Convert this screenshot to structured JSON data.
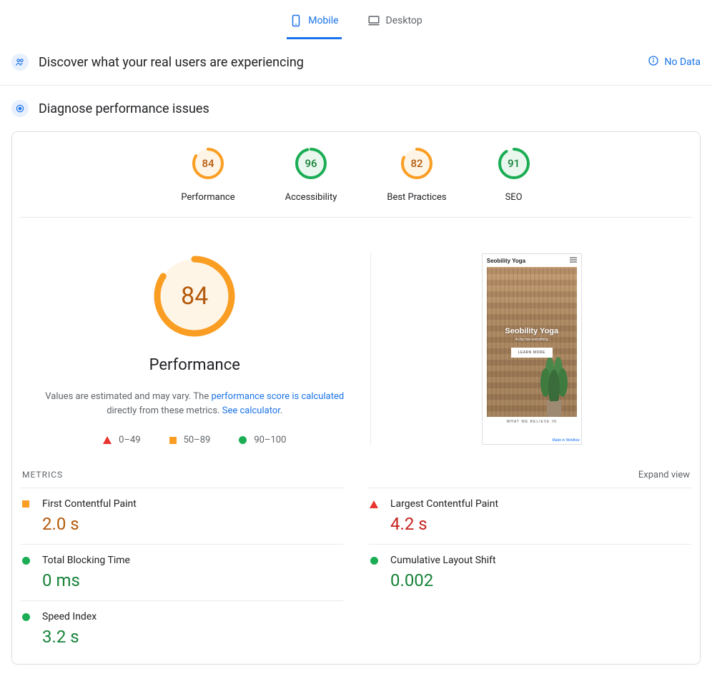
{
  "tabs": {
    "mobile": "Mobile",
    "desktop": "Desktop"
  },
  "discover": {
    "title": "Discover what your real users are experiencing",
    "no_data": "No Data"
  },
  "diagnose": {
    "title": "Diagnose performance issues"
  },
  "gauges": {
    "performance": {
      "label": "Performance",
      "score": "84"
    },
    "accessibility": {
      "label": "Accessibility",
      "score": "96"
    },
    "best_practices": {
      "label": "Best Practices",
      "score": "82"
    },
    "seo": {
      "label": "SEO",
      "score": "91"
    }
  },
  "perf_detail": {
    "score": "84",
    "title": "Performance",
    "desc_pre": "Values are estimated and may vary. The ",
    "desc_link1": "performance score is calculated",
    "desc_mid": " directly from these metrics. ",
    "desc_link2": "See calculator",
    "desc_post": "."
  },
  "legend": {
    "r1": "0–49",
    "r2": "50–89",
    "r3": "90–100"
  },
  "thumbnail": {
    "brand": "Seobility Yoga",
    "hero_title": "Seobility Yoga",
    "hero_sub": "A city has everything",
    "hero_btn": "LEARN MORE",
    "footer": "WHAT WE BELIEVE IN",
    "badge": "Made in Webflow"
  },
  "metrics_header": {
    "title": "METRICS",
    "expand": "Expand view"
  },
  "metrics": {
    "fcp": {
      "name": "First Contentful Paint",
      "value": "2.0 s"
    },
    "lcp": {
      "name": "Largest Contentful Paint",
      "value": "4.2 s"
    },
    "tbt": {
      "name": "Total Blocking Time",
      "value": "0 ms"
    },
    "cls": {
      "name": "Cumulative Layout Shift",
      "value": "0.002"
    },
    "si": {
      "name": "Speed Index",
      "value": "3.2 s"
    }
  },
  "colors": {
    "orange": "#fa9d23",
    "green": "#1aad53",
    "red": "#e8352f",
    "orange_fill": "#fff5e6",
    "green_fill": "#e9f7ee"
  },
  "chart_data": [
    {
      "type": "pie",
      "title": "Performance",
      "values": [
        84,
        16
      ],
      "categories": [
        "score",
        "remaining"
      ],
      "ylim": [
        0,
        100
      ]
    },
    {
      "type": "pie",
      "title": "Accessibility",
      "values": [
        96,
        4
      ],
      "categories": [
        "score",
        "remaining"
      ],
      "ylim": [
        0,
        100
      ]
    },
    {
      "type": "pie",
      "title": "Best Practices",
      "values": [
        82,
        18
      ],
      "categories": [
        "score",
        "remaining"
      ],
      "ylim": [
        0,
        100
      ]
    },
    {
      "type": "pie",
      "title": "SEO",
      "values": [
        91,
        9
      ],
      "categories": [
        "score",
        "remaining"
      ],
      "ylim": [
        0,
        100
      ]
    }
  ]
}
